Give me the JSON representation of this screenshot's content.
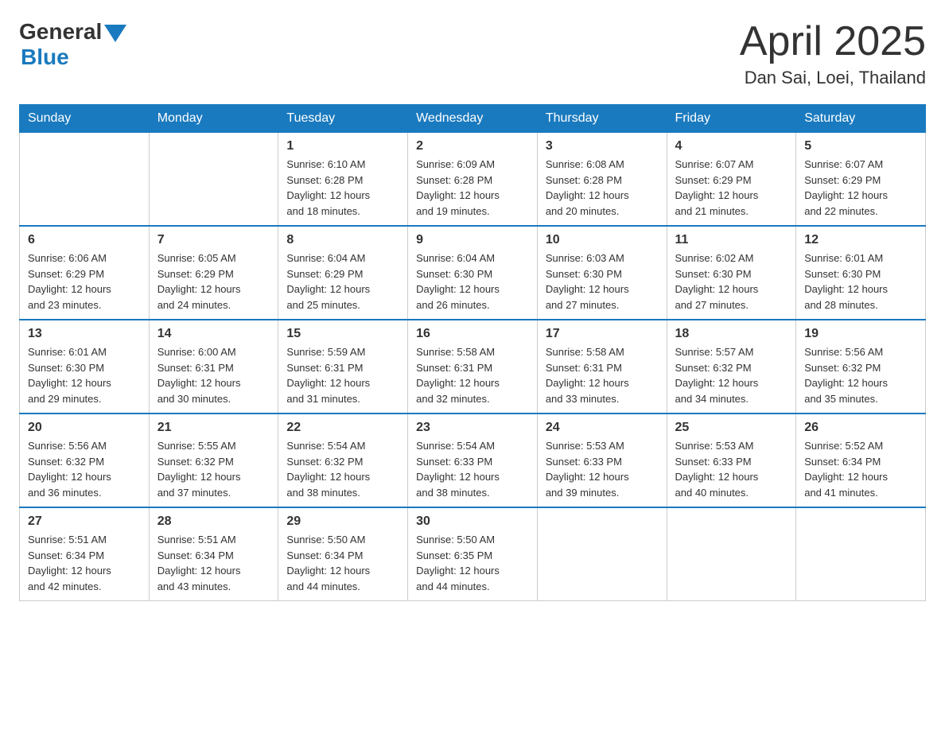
{
  "header": {
    "logo_general": "General",
    "logo_blue": "Blue",
    "month": "April 2025",
    "location": "Dan Sai, Loei, Thailand"
  },
  "weekdays": [
    "Sunday",
    "Monday",
    "Tuesday",
    "Wednesday",
    "Thursday",
    "Friday",
    "Saturday"
  ],
  "weeks": [
    [
      {
        "day": "",
        "info": ""
      },
      {
        "day": "",
        "info": ""
      },
      {
        "day": "1",
        "info": "Sunrise: 6:10 AM\nSunset: 6:28 PM\nDaylight: 12 hours\nand 18 minutes."
      },
      {
        "day": "2",
        "info": "Sunrise: 6:09 AM\nSunset: 6:28 PM\nDaylight: 12 hours\nand 19 minutes."
      },
      {
        "day": "3",
        "info": "Sunrise: 6:08 AM\nSunset: 6:28 PM\nDaylight: 12 hours\nand 20 minutes."
      },
      {
        "day": "4",
        "info": "Sunrise: 6:07 AM\nSunset: 6:29 PM\nDaylight: 12 hours\nand 21 minutes."
      },
      {
        "day": "5",
        "info": "Sunrise: 6:07 AM\nSunset: 6:29 PM\nDaylight: 12 hours\nand 22 minutes."
      }
    ],
    [
      {
        "day": "6",
        "info": "Sunrise: 6:06 AM\nSunset: 6:29 PM\nDaylight: 12 hours\nand 23 minutes."
      },
      {
        "day": "7",
        "info": "Sunrise: 6:05 AM\nSunset: 6:29 PM\nDaylight: 12 hours\nand 24 minutes."
      },
      {
        "day": "8",
        "info": "Sunrise: 6:04 AM\nSunset: 6:29 PM\nDaylight: 12 hours\nand 25 minutes."
      },
      {
        "day": "9",
        "info": "Sunrise: 6:04 AM\nSunset: 6:30 PM\nDaylight: 12 hours\nand 26 minutes."
      },
      {
        "day": "10",
        "info": "Sunrise: 6:03 AM\nSunset: 6:30 PM\nDaylight: 12 hours\nand 27 minutes."
      },
      {
        "day": "11",
        "info": "Sunrise: 6:02 AM\nSunset: 6:30 PM\nDaylight: 12 hours\nand 27 minutes."
      },
      {
        "day": "12",
        "info": "Sunrise: 6:01 AM\nSunset: 6:30 PM\nDaylight: 12 hours\nand 28 minutes."
      }
    ],
    [
      {
        "day": "13",
        "info": "Sunrise: 6:01 AM\nSunset: 6:30 PM\nDaylight: 12 hours\nand 29 minutes."
      },
      {
        "day": "14",
        "info": "Sunrise: 6:00 AM\nSunset: 6:31 PM\nDaylight: 12 hours\nand 30 minutes."
      },
      {
        "day": "15",
        "info": "Sunrise: 5:59 AM\nSunset: 6:31 PM\nDaylight: 12 hours\nand 31 minutes."
      },
      {
        "day": "16",
        "info": "Sunrise: 5:58 AM\nSunset: 6:31 PM\nDaylight: 12 hours\nand 32 minutes."
      },
      {
        "day": "17",
        "info": "Sunrise: 5:58 AM\nSunset: 6:31 PM\nDaylight: 12 hours\nand 33 minutes."
      },
      {
        "day": "18",
        "info": "Sunrise: 5:57 AM\nSunset: 6:32 PM\nDaylight: 12 hours\nand 34 minutes."
      },
      {
        "day": "19",
        "info": "Sunrise: 5:56 AM\nSunset: 6:32 PM\nDaylight: 12 hours\nand 35 minutes."
      }
    ],
    [
      {
        "day": "20",
        "info": "Sunrise: 5:56 AM\nSunset: 6:32 PM\nDaylight: 12 hours\nand 36 minutes."
      },
      {
        "day": "21",
        "info": "Sunrise: 5:55 AM\nSunset: 6:32 PM\nDaylight: 12 hours\nand 37 minutes."
      },
      {
        "day": "22",
        "info": "Sunrise: 5:54 AM\nSunset: 6:32 PM\nDaylight: 12 hours\nand 38 minutes."
      },
      {
        "day": "23",
        "info": "Sunrise: 5:54 AM\nSunset: 6:33 PM\nDaylight: 12 hours\nand 38 minutes."
      },
      {
        "day": "24",
        "info": "Sunrise: 5:53 AM\nSunset: 6:33 PM\nDaylight: 12 hours\nand 39 minutes."
      },
      {
        "day": "25",
        "info": "Sunrise: 5:53 AM\nSunset: 6:33 PM\nDaylight: 12 hours\nand 40 minutes."
      },
      {
        "day": "26",
        "info": "Sunrise: 5:52 AM\nSunset: 6:34 PM\nDaylight: 12 hours\nand 41 minutes."
      }
    ],
    [
      {
        "day": "27",
        "info": "Sunrise: 5:51 AM\nSunset: 6:34 PM\nDaylight: 12 hours\nand 42 minutes."
      },
      {
        "day": "28",
        "info": "Sunrise: 5:51 AM\nSunset: 6:34 PM\nDaylight: 12 hours\nand 43 minutes."
      },
      {
        "day": "29",
        "info": "Sunrise: 5:50 AM\nSunset: 6:34 PM\nDaylight: 12 hours\nand 44 minutes."
      },
      {
        "day": "30",
        "info": "Sunrise: 5:50 AM\nSunset: 6:35 PM\nDaylight: 12 hours\nand 44 minutes."
      },
      {
        "day": "",
        "info": ""
      },
      {
        "day": "",
        "info": ""
      },
      {
        "day": "",
        "info": ""
      }
    ]
  ]
}
